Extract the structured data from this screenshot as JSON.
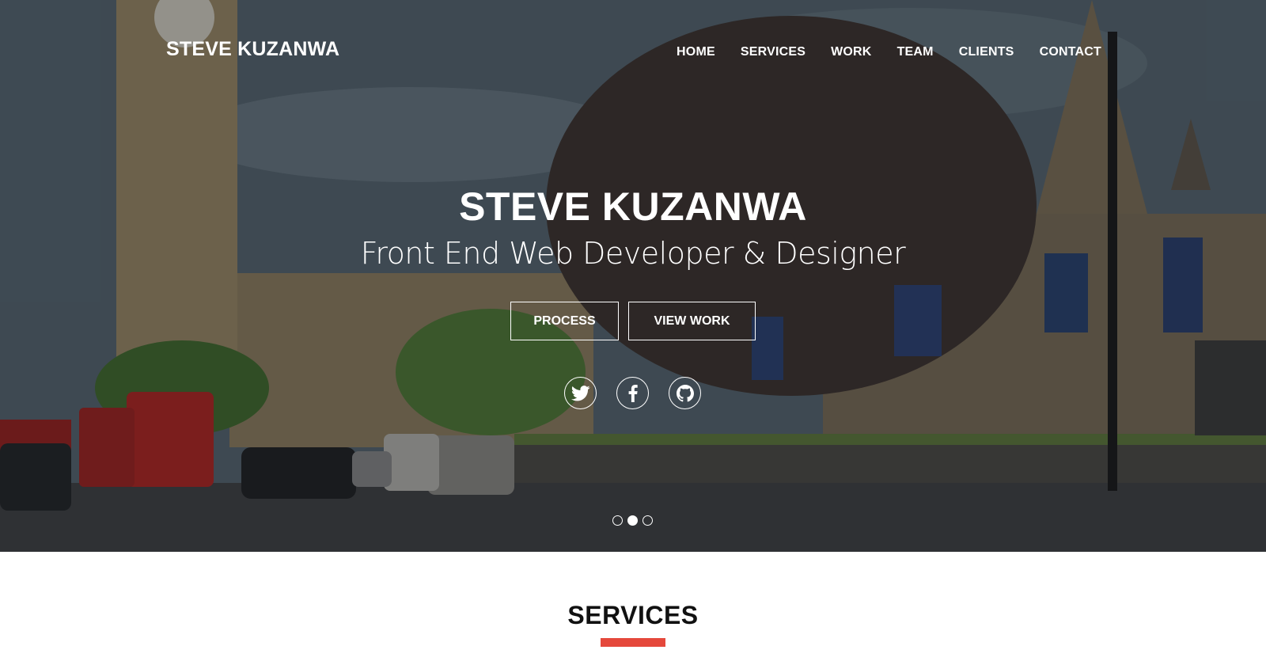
{
  "brand": "STEVE KUZANWA",
  "nav": {
    "items": [
      {
        "label": "HOME"
      },
      {
        "label": "SERVICES"
      },
      {
        "label": "WORK"
      },
      {
        "label": "TEAM"
      },
      {
        "label": "CLIENTS"
      },
      {
        "label": "CONTACT"
      }
    ]
  },
  "hero": {
    "title": "STEVE KUZANWA",
    "subtitle": "Front End Web Developer & Designer",
    "buttons": {
      "process": "PROCESS",
      "view_work": "VIEW WORK"
    },
    "social": [
      "twitter-icon",
      "facebook-icon",
      "github-icon"
    ],
    "carousel": {
      "slides": 3,
      "active_index": 1
    }
  },
  "services": {
    "title": "SERVICES",
    "accent_color": "#e5483b"
  }
}
